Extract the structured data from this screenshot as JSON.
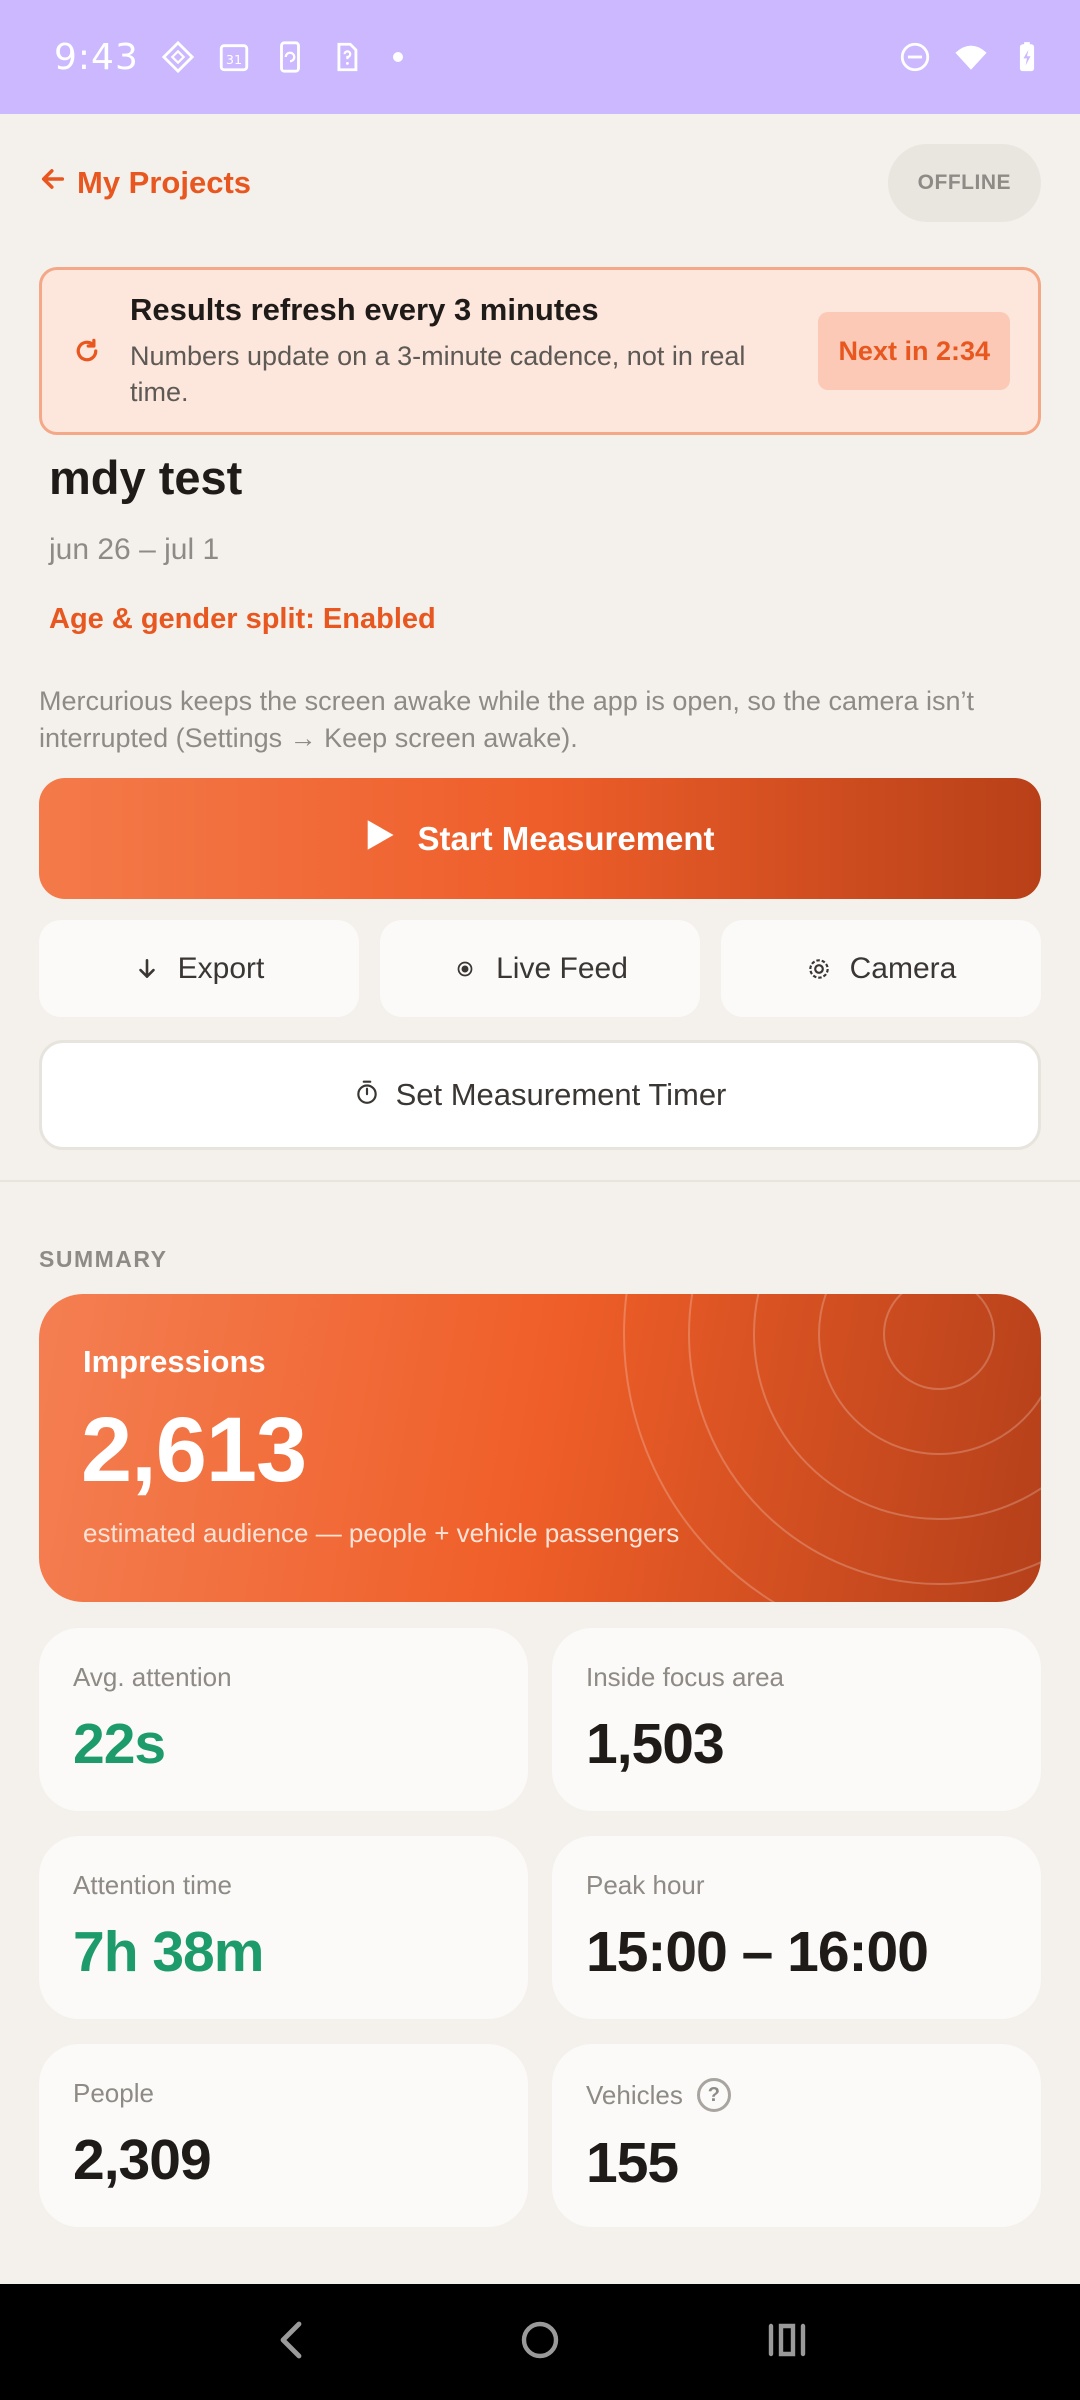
{
  "status_bar": {
    "time": "9:43",
    "calendar_day": "31"
  },
  "header": {
    "back_label": "My Projects",
    "offline_label": "OFFLINE"
  },
  "banner": {
    "title": "Results refresh every 3 minutes",
    "subtitle": "Numbers update on a 3-minute cadence, not in real time.",
    "next_label": "Next in 2:34"
  },
  "project": {
    "name": "mdy test",
    "date_range": "jun 26 – jul 1",
    "split_status": "Age & gender split: Enabled",
    "awake_note": "Mercurious keeps the screen awake while the app is open, so the camera isn’t interrupted (Settings → Keep screen awake)."
  },
  "actions": {
    "start_label": "Start Measurement",
    "export_label": "Export",
    "live_feed_label": "Live Feed",
    "camera_label": "Camera",
    "timer_label": "Set Measurement Timer"
  },
  "summary": {
    "section_label": "SUMMARY",
    "impressions": {
      "label": "Impressions",
      "value": "2,613",
      "subtitle": "estimated audience — people + vehicle passengers"
    },
    "stats": [
      {
        "label": "Avg. attention",
        "value": "22s",
        "accent": "green"
      },
      {
        "label": "Inside focus area",
        "value": "1,503",
        "accent": "dark"
      },
      {
        "label": "Attention time",
        "value": "7h 38m",
        "accent": "green"
      },
      {
        "label": "Peak hour",
        "value": "15:00 – 16:00",
        "accent": "dark"
      },
      {
        "label": "People",
        "value": "2,309",
        "accent": "dark"
      },
      {
        "label": "Vehicles",
        "value": "155",
        "accent": "dark",
        "help_glyph": "?"
      }
    ]
  },
  "colors": {
    "accent": "#E8571F",
    "status_bar": "#CBB8FF",
    "background": "#F4F1EC",
    "positive": "#1E9B6A"
  }
}
